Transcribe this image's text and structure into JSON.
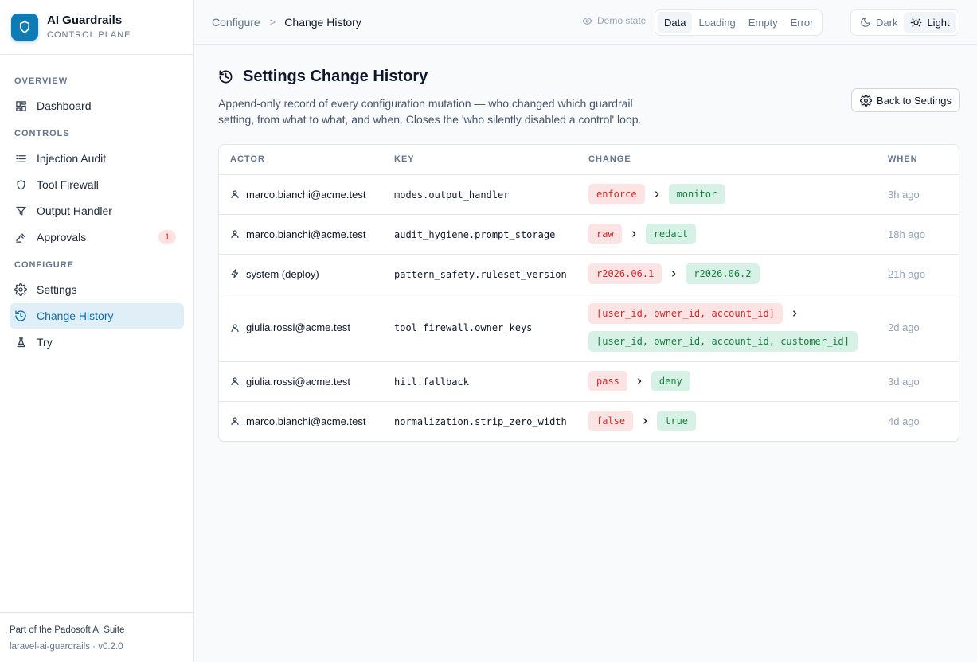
{
  "brand": {
    "title": "AI Guardrails",
    "subtitle": "CONTROL PLANE"
  },
  "nav": {
    "overview_label": "OVERVIEW",
    "controls_label": "CONTROLS",
    "configure_label": "CONFIGURE",
    "items": {
      "dashboard": "Dashboard",
      "injection_audit": "Injection Audit",
      "tool_firewall": "Tool Firewall",
      "output_handler": "Output Handler",
      "approvals": "Approvals",
      "approvals_badge": "1",
      "settings": "Settings",
      "change_history": "Change History",
      "try": "Try"
    }
  },
  "footer": {
    "line1": "Part of the Padosoft AI Suite",
    "line2": "laravel-ai-guardrails · v0.2.0"
  },
  "breadcrumb": {
    "parent": "Configure",
    "separator": ">",
    "current": "Change History"
  },
  "demo": {
    "label": "Demo state",
    "states": [
      "Data",
      "Loading",
      "Empty",
      "Error"
    ],
    "selected_state": "Data"
  },
  "theme": {
    "options": [
      "Dark",
      "Light"
    ],
    "selected": "Light"
  },
  "page": {
    "title": "Settings Change History",
    "description": "Append-only record of every configuration mutation — who changed which guardrail setting, from what to what, and when. Closes the 'who silently disabled a control' loop.",
    "back_button": "Back to Settings"
  },
  "table": {
    "headers": {
      "actor": "ACTOR",
      "key": "KEY",
      "change": "CHANGE",
      "when": "WHEN"
    },
    "rows": [
      {
        "actor": "marco.bianchi@acme.test",
        "actor_type": "user",
        "key": "modes.output_handler",
        "from": "enforce",
        "to": "monitor",
        "when": "3h ago"
      },
      {
        "actor": "marco.bianchi@acme.test",
        "actor_type": "user",
        "key": "audit_hygiene.prompt_storage",
        "from": "raw",
        "to": "redact",
        "when": "18h ago"
      },
      {
        "actor": "system (deploy)",
        "actor_type": "system",
        "key": "pattern_safety.ruleset_version",
        "from": "r2026.06.1",
        "to": "r2026.06.2",
        "when": "21h ago"
      },
      {
        "actor": "giulia.rossi@acme.test",
        "actor_type": "user",
        "key": "tool_firewall.owner_keys",
        "from": "[user_id, owner_id, account_id]",
        "to": "[user_id, owner_id, account_id, customer_id]",
        "when": "2d ago"
      },
      {
        "actor": "giulia.rossi@acme.test",
        "actor_type": "user",
        "key": "hitl.fallback",
        "from": "pass",
        "to": "deny",
        "when": "3d ago"
      },
      {
        "actor": "marco.bianchi@acme.test",
        "actor_type": "user",
        "key": "normalization.strip_zero_width",
        "from": "false",
        "to": "true",
        "when": "4d ago"
      }
    ]
  },
  "colors": {
    "accent": "#0e7bb5",
    "active_bg": "#e0eef7",
    "from_bg": "#fde4e4",
    "from_text": "#dc2626",
    "to_bg": "#d8f1e6",
    "to_text": "#15803d"
  }
}
